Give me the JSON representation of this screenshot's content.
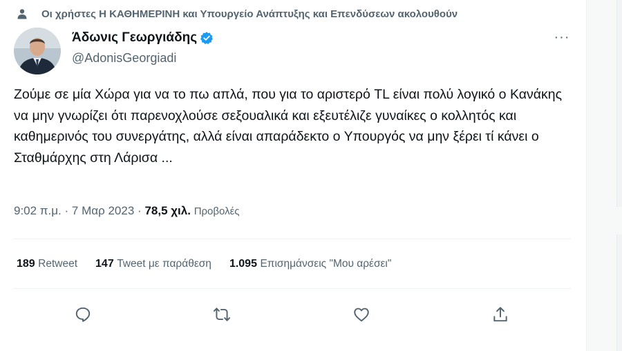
{
  "social_context": {
    "text": "Οι χρήστες Η ΚΑΘΗΜΕΡΙΝΗ και Υπουργείο Ανάπτυξης και Επενδύσεων ακολουθούν",
    "icon": "person-icon"
  },
  "author": {
    "name": "Άδωνις Γεωργιάδης",
    "handle": "@AdonisGeorgiadi",
    "verified_color": "#1d9bf0"
  },
  "more_label": "···",
  "tweet": {
    "text": "Ζούμε σε μία Χώρα για να το πω απλά, που για το αριστερό TL είναι πολύ λογικό ο Κανάκης να μην γνωρίζει ότι παρενοχλούσε σεξουαλικά και εξευτέλιζε γυναίκες ο κολλητός και καθημερινός του συνεργάτης, αλλά είναι απαράδεκτο ο Υπουργός να μην ξέρει τί κάνει ο Σταθμάρχης στη Λάρισα ...",
    "time": "9:02 π.μ.",
    "separator": "·",
    "date": "7 Μαρ 2023",
    "views_count": "78,5 χιλ.",
    "views_label": "Προβολές"
  },
  "stats": [
    {
      "count": "189",
      "label": "Retweet"
    },
    {
      "count": "147",
      "label": "Tweet με παράθεση"
    },
    {
      "count": "1.095",
      "label": "Επισημάνσεις \"Μου αρέσει\""
    }
  ],
  "actions": [
    {
      "name": "reply-icon"
    },
    {
      "name": "retweet-icon"
    },
    {
      "name": "like-icon"
    },
    {
      "name": "share-icon"
    }
  ],
  "colors": {
    "secondary_text": "#536471",
    "primary_text": "#0f1419",
    "accent": "#1d9bf0"
  }
}
